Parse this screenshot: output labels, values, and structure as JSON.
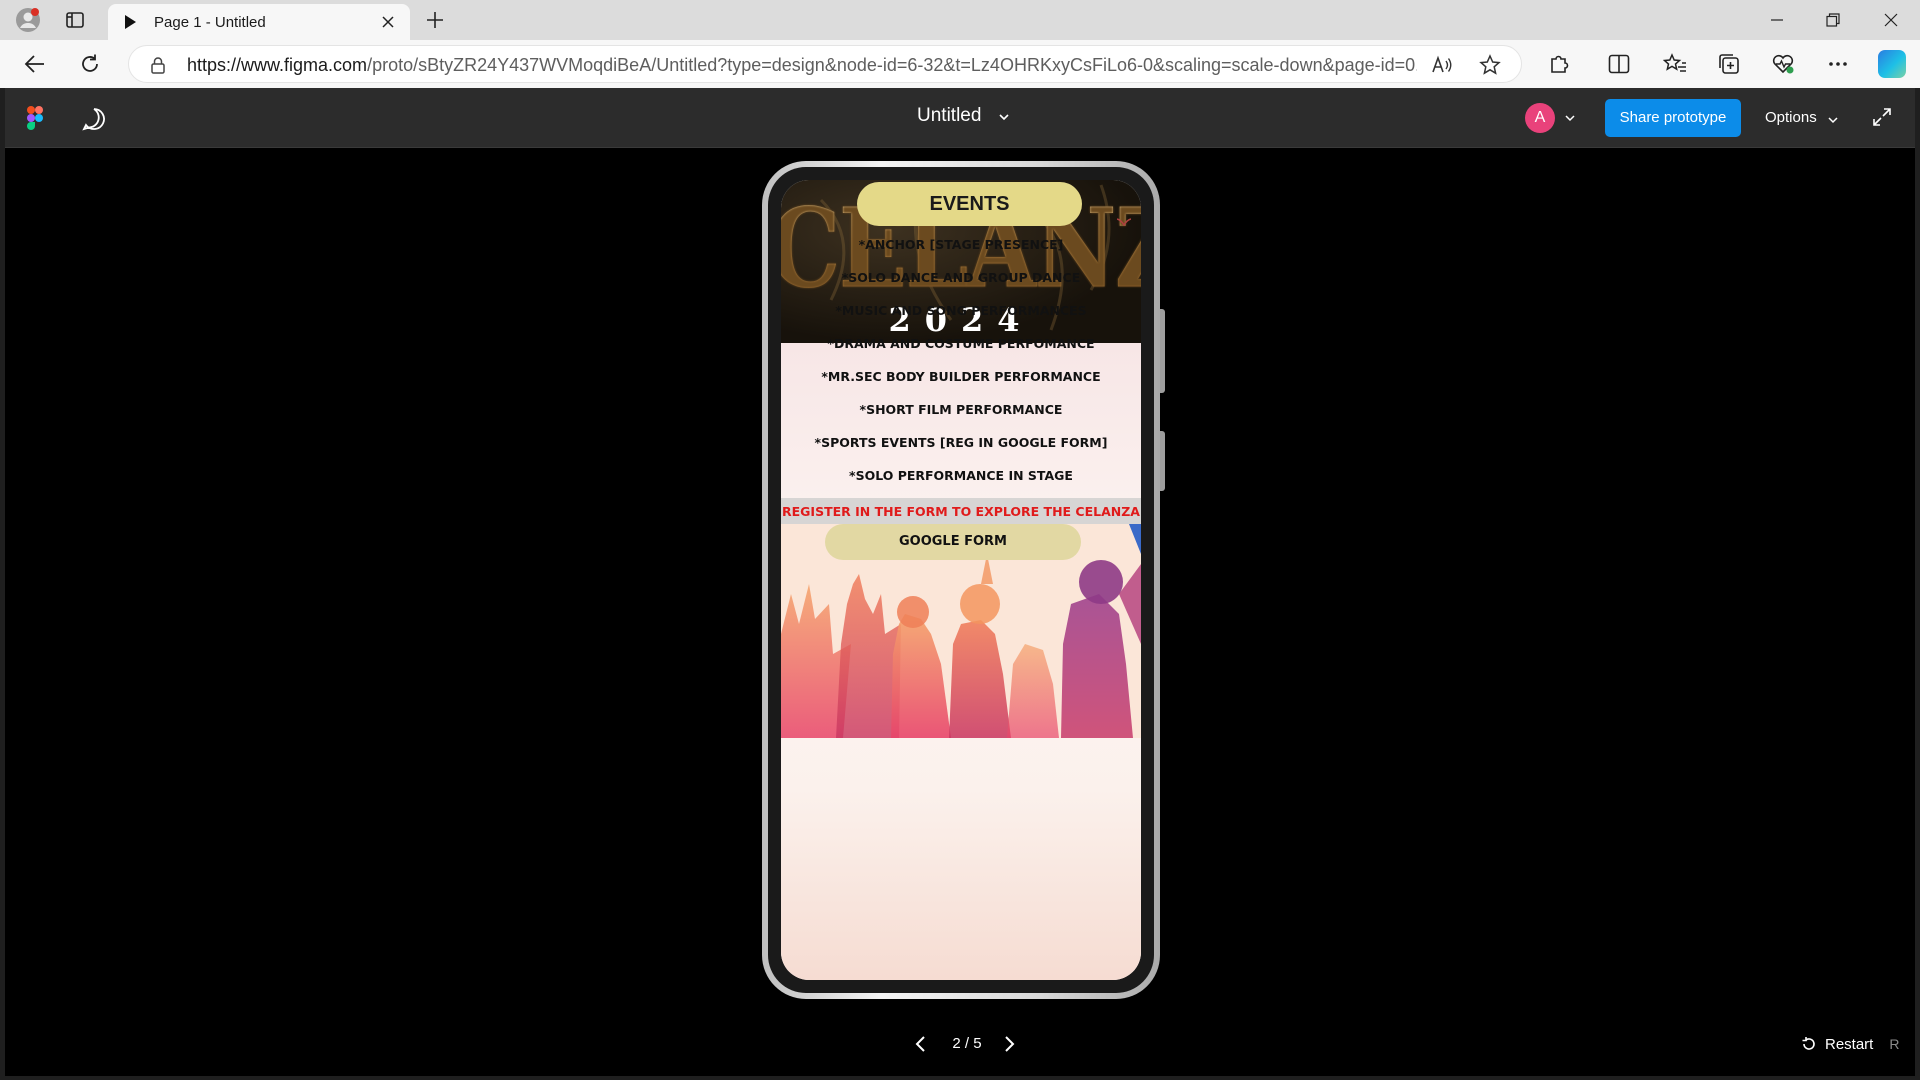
{
  "browser": {
    "tab_title": "Page 1 - Untitled",
    "url_domain": "https://www.figma.com",
    "url_path": "/proto/sBtyZR24Y437WVMoqdiBeA/Untitled?type=design&node-id=6-32&t=Lz4OHRKxyCsFiLo6-0&scaling=scale-down&page-id=0..."
  },
  "figma": {
    "doc_title": "Untitled",
    "avatar_initial": "A",
    "share_label": "Share prototype",
    "options_label": "Options",
    "colors": {
      "share": "#0c8ce9",
      "avatar": "#e9427b"
    }
  },
  "prototype": {
    "hero_title": "CELANZA",
    "hero_year": "2024",
    "events_heading": "EVENTS",
    "events": [
      "*ANCHOR [STAGE PRESENCE]",
      "*SOLO DANCE AND GROUP DANCE",
      "*MUSIC AND SONG PERFORMANCES",
      "*DRAMA AND COSTUME PERFOMANCE",
      "*MR.SEC BODY BUILDER PERFORMANCE",
      "*SHORT FILM PERFORMANCE",
      "*SPORTS EVENTS [REG IN GOOGLE FORM]",
      "*SOLO PERFORMANCE IN STAGE"
    ],
    "register_text": "REGISTER IN THE  FORM TO EXPLORE THE CELANZA",
    "google_form_label": "GOOGLE FORM"
  },
  "pager": {
    "text": "2 / 5",
    "restart_label": "Restart",
    "restart_key": "R"
  }
}
